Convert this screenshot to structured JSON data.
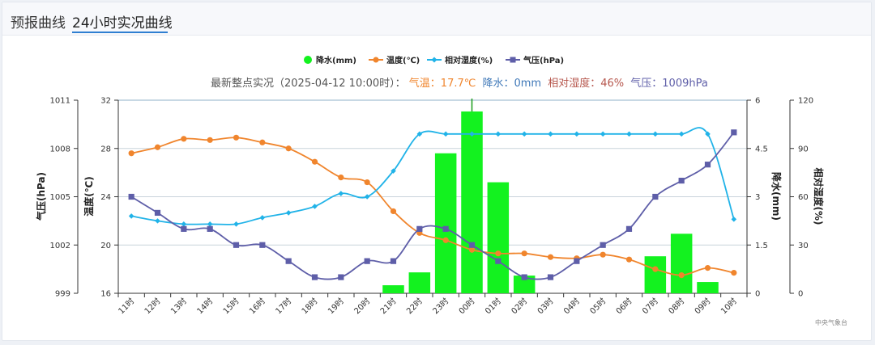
{
  "tabs": [
    {
      "label": "预报曲线",
      "active": false
    },
    {
      "label": "24小时实况曲线",
      "active": true
    }
  ],
  "status": {
    "prefix": "最新整点实况（2025-04-12 10:00时）：",
    "temp": "气温：17.7℃",
    "rain": "降水：0mm",
    "humidity": "相对湿度：46%",
    "pressure": "气压：1009hPa"
  },
  "credit": "中央气象台",
  "colors": {
    "rain": "#13f21f",
    "temp": "#f0852d",
    "humidity": "#21b3e8",
    "pressure": "#5e5ea8"
  },
  "chart_data": {
    "type": "line",
    "categories": [
      "11时",
      "12时",
      "13时",
      "14时",
      "15时",
      "16时",
      "17时",
      "18时",
      "19时",
      "20时",
      "21时",
      "22时",
      "23时",
      "00时",
      "01时",
      "02时",
      "03时",
      "04时",
      "05时",
      "06时",
      "07时",
      "08时",
      "09时",
      "10时"
    ],
    "legend": [
      "降水(mm)",
      "温度(℃)",
      "相对湿度(%)",
      "气压(hPa)"
    ],
    "legend_position": "top-center",
    "axes": {
      "pressure": {
        "label": "气压(hPa)",
        "range": [
          999,
          1011
        ],
        "ticks": [
          "999",
          "1002",
          "1005",
          "1008",
          "1011"
        ]
      },
      "temp": {
        "label": "温度(℃)",
        "range": [
          16,
          32
        ],
        "ticks": [
          "16",
          "20",
          "24",
          "28",
          "32"
        ]
      },
      "rain": {
        "label": "降水(mm)",
        "range": [
          0,
          6
        ],
        "ticks": [
          "0",
          "1.5",
          "3",
          "4.5",
          "6"
        ]
      },
      "humidity": {
        "label": "相对湿度(%)",
        "range": [
          0,
          120
        ],
        "ticks": [
          "0",
          "30",
          "60",
          "90",
          "120"
        ]
      }
    },
    "grid": true,
    "series": [
      {
        "name": "降水(mm)",
        "type": "bar",
        "axis": "rain",
        "values": [
          0,
          0,
          0,
          0,
          0,
          0,
          0,
          0,
          0,
          0,
          0.25,
          0.65,
          4.35,
          5.65,
          3.45,
          0.55,
          0,
          0,
          0,
          0,
          1.15,
          1.85,
          0.35,
          0
        ]
      },
      {
        "name": "温度(℃)",
        "type": "line",
        "axis": "temp",
        "values": [
          27.6,
          28.1,
          28.8,
          28.7,
          28.9,
          28.5,
          28.0,
          26.9,
          25.6,
          25.2,
          22.8,
          21.0,
          20.4,
          19.6,
          19.3,
          19.3,
          19.0,
          18.9,
          19.2,
          18.8,
          18.0,
          17.5,
          18.1,
          17.7
        ]
      },
      {
        "name": "相对湿度(%)",
        "type": "line",
        "axis": "humidity",
        "values": [
          48,
          45,
          43,
          43,
          43,
          47,
          50,
          54,
          62,
          60,
          76,
          99,
          99,
          99,
          99,
          99,
          99,
          99,
          99,
          99,
          99,
          99,
          99,
          46
        ]
      },
      {
        "name": "气压(hPa)",
        "type": "line",
        "axis": "pressure",
        "values": [
          1005,
          1004,
          1003,
          1003,
          1002,
          1002,
          1001,
          1000,
          1000,
          1001,
          1001,
          1003,
          1003,
          1002,
          1001,
          1000,
          1000,
          1001,
          1002,
          1003,
          1005,
          1006,
          1007,
          1009
        ]
      }
    ]
  }
}
